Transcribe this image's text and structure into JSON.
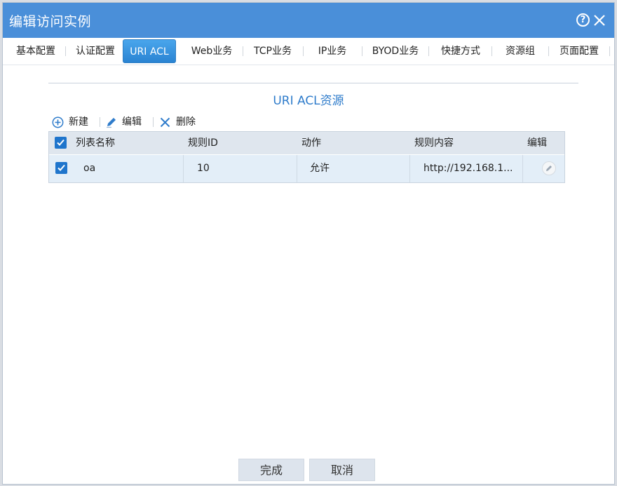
{
  "dialog": {
    "title": "编辑访问实例"
  },
  "tabs": [
    {
      "label": "基本配置"
    },
    {
      "label": "认证配置"
    },
    {
      "label": "URI ACL"
    },
    {
      "label": "Web业务"
    },
    {
      "label": "TCP业务"
    },
    {
      "label": "IP业务"
    },
    {
      "label": "BYOD业务"
    },
    {
      "label": "快捷方式"
    },
    {
      "label": "资源组"
    },
    {
      "label": "页面配置"
    }
  ],
  "section": {
    "title": "URI ACL资源"
  },
  "toolbar": {
    "new_label": "新建",
    "edit_label": "编辑",
    "delete_label": "删除"
  },
  "table": {
    "columns": [
      "列表名称",
      "规则ID",
      "动作",
      "规则内容",
      "编辑"
    ],
    "rows": [
      {
        "name": "oa",
        "rule_id": "10",
        "action": "允许",
        "content": "http://192.168.1..."
      }
    ]
  },
  "footer": {
    "done_label": "完成",
    "cancel_label": "取消"
  },
  "colors": {
    "accent": "#4a8fd9",
    "active_tab": "#2a83d2",
    "section_title": "#2f7ccb"
  }
}
